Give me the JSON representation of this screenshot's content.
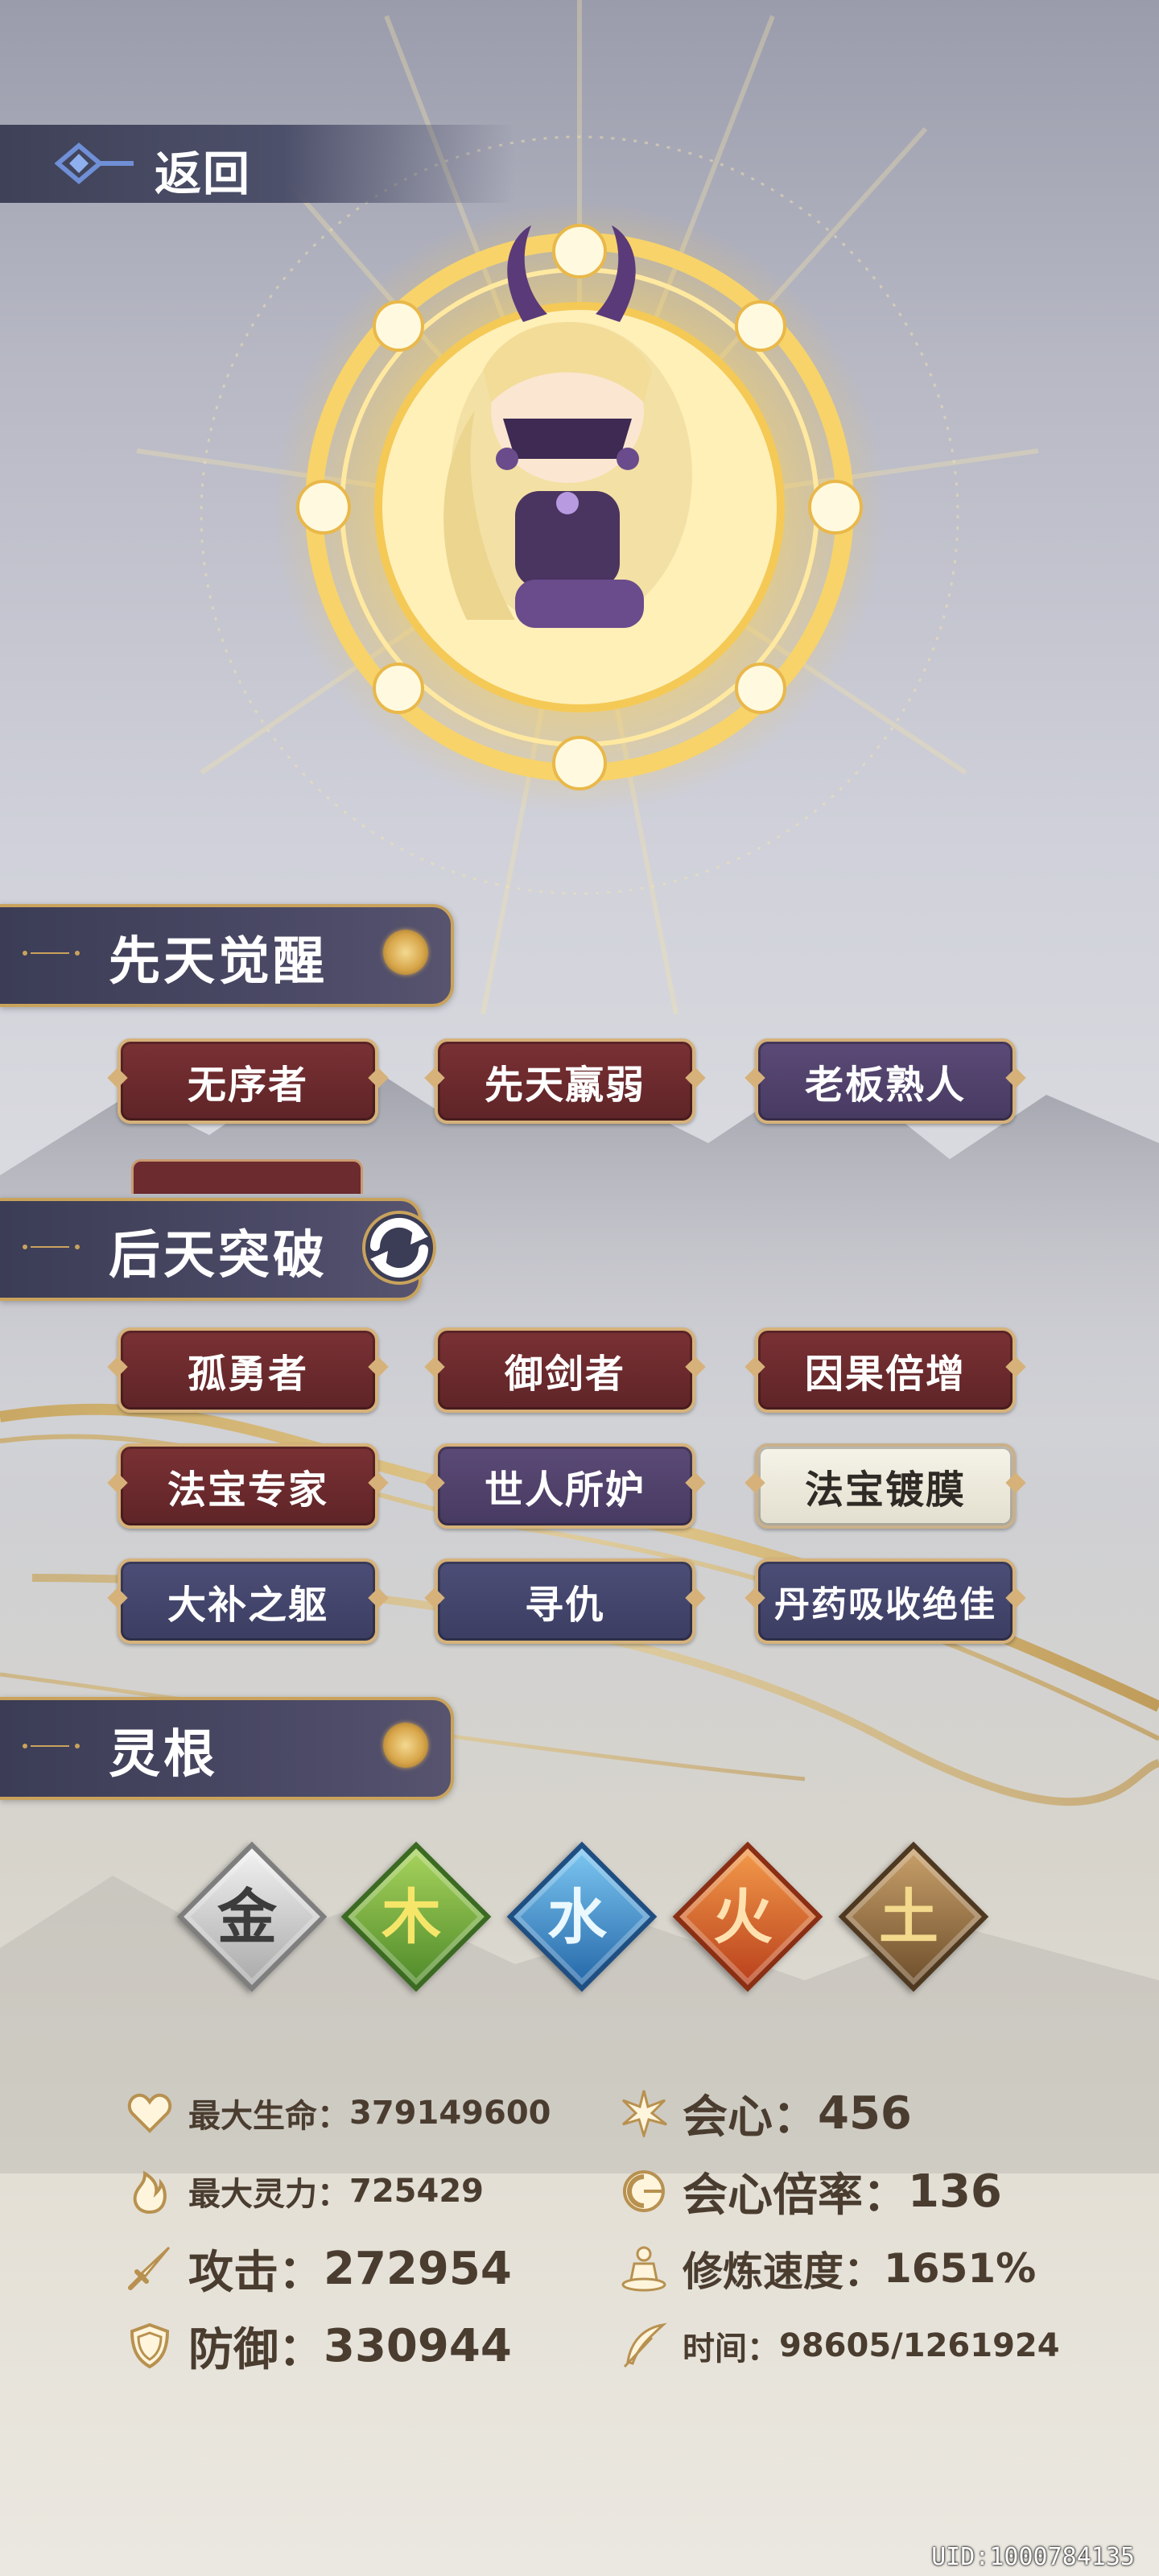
{
  "header": {
    "back_label": "返回"
  },
  "sections": {
    "innate": {
      "title": "先天觉醒",
      "tags": [
        "无序者",
        "先天羸弱",
        "老板熟人"
      ]
    },
    "acquired": {
      "title": "后天突破",
      "tags": [
        "孤勇者",
        "御剑者",
        "因果倍增",
        "法宝专家",
        "世人所妒",
        "法宝镀膜",
        "大补之躯",
        "寻仇",
        "丹药吸收绝佳"
      ]
    },
    "roots": {
      "title": "灵根",
      "elements": [
        "金",
        "木",
        "水",
        "火",
        "土"
      ]
    }
  },
  "stats": {
    "max_hp_label": "最大生命：",
    "max_hp_value": "379149600",
    "max_mp_label": "最大灵力：",
    "max_mp_value": "725429",
    "attack_label": "攻击：",
    "attack_value": "272954",
    "defense_label": "防御：",
    "defense_value": "330944",
    "crit_label": "会心：",
    "crit_value": "456",
    "crit_rate_label": "会心倍率：",
    "crit_rate_value": "136",
    "cultivation_label": "修炼速度：",
    "cultivation_value": "1651%",
    "time_label": "时间：",
    "time_value": "98605/1261924"
  },
  "footer": {
    "uid": "UID:1000784135"
  },
  "colors": {
    "accent_gold": "#c9a35c",
    "tag_red": "#6c2b2e",
    "tag_purple": "#514369",
    "tag_blue": "#43466c",
    "metal": "#b8b8b8",
    "wood": "#6ea23a",
    "water": "#3a86c8",
    "fire": "#d65a22",
    "earth": "#8c6a3e"
  },
  "icons": [
    "diamond-arrow-icon",
    "heart-icon",
    "flame-icon",
    "sword-icon",
    "shield-icon",
    "burst-icon",
    "crescent-icon",
    "meditation-icon",
    "feather-icon",
    "rotate-icon"
  ]
}
